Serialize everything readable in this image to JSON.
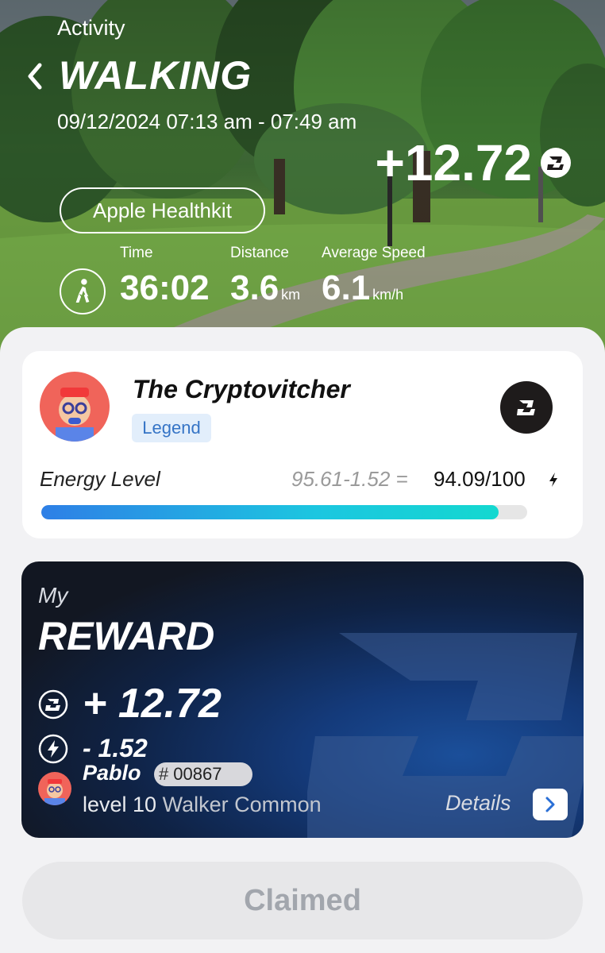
{
  "header": {
    "section_label": "Activity",
    "title": "WALKING",
    "date_range": "09/12/2024 07:13 am - 07:49 am",
    "reward": "+12.72",
    "source": "Apple Healthkit",
    "stats": {
      "time_label": "Time",
      "time_value": "36:02",
      "distance_label": "Distance",
      "distance_value": "3.6",
      "distance_unit": "km",
      "speed_label": "Average Speed",
      "speed_value": "6.1",
      "speed_unit": "km/h"
    }
  },
  "profile": {
    "username": "The Cryptovitcher",
    "tier": "Legend",
    "energy_label": "Energy Level",
    "energy_calc": "95.61-1.52 =",
    "energy_value": "94.09/100",
    "energy_fraction": 0.9409
  },
  "reward_card": {
    "my_label": "My",
    "title": "REWARD",
    "token_reward": "+ 12.72",
    "energy_cost": "- 1.52",
    "nft_name": "Pablo",
    "nft_id": "00867",
    "nft_level": "level 10",
    "nft_rarity": "Walker Common",
    "details_label": "Details"
  },
  "claim_button": {
    "label": "Claimed"
  },
  "colors": {
    "accent_blue": "#2e7fe6",
    "accent_cyan": "#14d8d0",
    "tier_badge_text": "#3574c6",
    "card_dark": "#0f2244"
  },
  "icons": [
    "back-chevron-icon",
    "coin-icon",
    "walker-icon",
    "bolt-icon",
    "chevron-right-icon"
  ]
}
